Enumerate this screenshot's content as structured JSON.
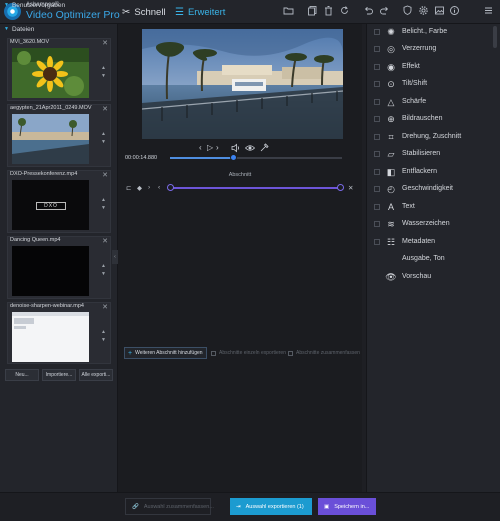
{
  "app": {
    "brand_small": "Ashampoo®",
    "brand_name": "Video Optimizer Pro",
    "accent": "#3ab4e8",
    "modes": {
      "quick": "Schnell",
      "advanced": "Erweitert"
    }
  },
  "toolbar_icons": [
    "folder-icon",
    "copy-icon",
    "trash-icon",
    "reset-icon",
    "undo-icon",
    "redo-icon",
    "gear-icon",
    "image-icon",
    "info-icon",
    "menu-icon"
  ],
  "files": {
    "header": "Dateien",
    "items": [
      {
        "name": "MVI_3620.MOV"
      },
      {
        "name": "aegypten_21Apr2011_0249.MOV"
      },
      {
        "name": "DXO-Pressekonferenz.mp4"
      },
      {
        "name": "Dancing Queen.mp4"
      },
      {
        "name": "denoise-sharpen-webinar.mp4"
      }
    ],
    "thumb_text": "DXO"
  },
  "presets": {
    "header": "Benutzervorgaben",
    "buttons": [
      "Neu...",
      "Importiere...",
      "Alle exporti..."
    ]
  },
  "player": {
    "timecode": "00:00:14.880",
    "progress": 0.37
  },
  "sections": {
    "label": "Abschnitt",
    "add_button": "Weiteren Abschnitt hinzufügen",
    "export_individual": "Abschnitte einzeln exportieren",
    "merge_sections": "Abschnitte zusammenfassen"
  },
  "filters": [
    {
      "label": "Belicht., Farbe",
      "icon": "brightness-icon"
    },
    {
      "label": "Verzerrung",
      "icon": "distortion-icon"
    },
    {
      "label": "Effekt",
      "icon": "effect-icon"
    },
    {
      "label": "Tilt/Shift",
      "icon": "tilt-shift-icon"
    },
    {
      "label": "Schärfe",
      "icon": "sharpen-icon"
    },
    {
      "label": "Bildrauschen",
      "icon": "noise-icon"
    },
    {
      "label": "Drehung, Zuschnitt",
      "icon": "rotate-crop-icon"
    },
    {
      "label": "Stabilisieren",
      "icon": "stabilize-icon"
    },
    {
      "label": "Entflackern",
      "icon": "deflicker-icon"
    },
    {
      "label": "Geschwindigkeit",
      "icon": "speed-icon"
    },
    {
      "label": "Text",
      "icon": "text-icon"
    },
    {
      "label": "Wasserzeichen",
      "icon": "watermark-icon"
    },
    {
      "label": "Metadaten",
      "icon": "metadata-icon"
    },
    {
      "label": "Ausgabe, Ton",
      "icon": "output-sound-icon"
    },
    {
      "label": "Vorschau",
      "icon": "preview-eye-icon"
    }
  ],
  "bottom": {
    "merge_selection": "Auswahl zusammenfassen...",
    "export_selection": "Auswahl exportieren (1)",
    "save": "Speichern in..."
  }
}
